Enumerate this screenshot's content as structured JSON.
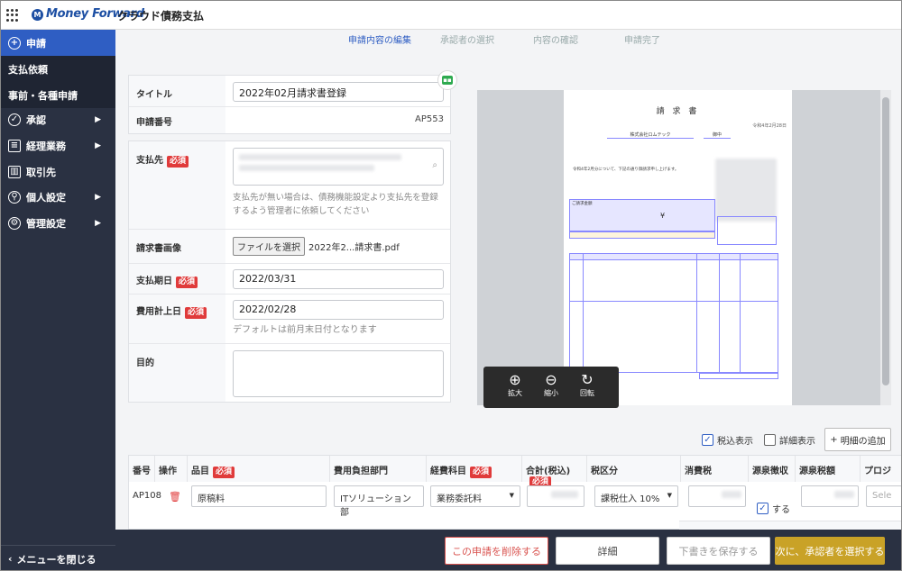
{
  "brand": {
    "name": "Money Forward",
    "product": "クラウド債務支払"
  },
  "sidebar": {
    "items": [
      {
        "label": "申請"
      },
      {
        "label": "支払依頼"
      },
      {
        "label": "事前・各種申請"
      },
      {
        "label": "承認"
      },
      {
        "label": "経理業務"
      },
      {
        "label": "取引先"
      },
      {
        "label": "個人設定"
      },
      {
        "label": "管理設定"
      }
    ],
    "close_label": "メニューを閉じる"
  },
  "steps": [
    "申請内容の編集",
    "承認者の選択",
    "内容の確認",
    "申請完了"
  ],
  "form": {
    "title_label": "タイトル",
    "title_value": "2022年02月請求書登録",
    "number_label": "申請番号",
    "number_value": "AP553",
    "payee_label": "支払先",
    "required": "必須",
    "payee_hint": "支払先が無い場合は、債務機能設定より支払先を登録するよう管理者に依頼してください",
    "invoice_label": "請求書画像",
    "file_button": "ファイルを選択",
    "file_name": "2022年2...請求書.pdf",
    "due_label": "支払期日",
    "due_value": "2022/03/31",
    "expense_label": "費用計上日",
    "expense_value": "2022/02/28",
    "expense_hint": "デフォルトは前月末日付となります",
    "purpose_label": "目的"
  },
  "viewer": {
    "doc_title": "請 求 書",
    "doc_company": "株式会社ロムテック",
    "doc_honorific": "御中",
    "doc_date": "令和4年2月28日",
    "doc_greeting": "令和4年2月分について、下記の通り御請求申し上げます。",
    "doc_amount_label": "ご請求金額",
    "doc_currency": "¥",
    "zoom_in": "拡大",
    "zoom_out": "縮小",
    "rotate": "回転"
  },
  "options": {
    "tax_included": "税込表示",
    "detail_view": "詳細表示",
    "add_detail": "明細の追加"
  },
  "table": {
    "headers": [
      "番号",
      "操作",
      "品目",
      "費用負担部門",
      "経費科目",
      "合計(税込)",
      "税区分",
      "消費税",
      "源泉徴収",
      "源泉税額",
      "プロジ"
    ],
    "row": {
      "number": "AP108",
      "item": "原稿料",
      "department": "ITソリューション部",
      "account": "業務委託料",
      "tax_category": "課税仕入 10%",
      "withholding": "する",
      "project_placeholder": "Sele"
    }
  },
  "footer": {
    "delete": "この申請を削除する",
    "detail": "詳細",
    "save_draft": "下書きを保存する",
    "next": "次に、承認者を選択する"
  },
  "colors": {
    "primary": "#2f5ec3",
    "sidebar": "#2a3142",
    "required": "#e03b3b",
    "next": "#c9a227",
    "delete": "#d9534f"
  }
}
